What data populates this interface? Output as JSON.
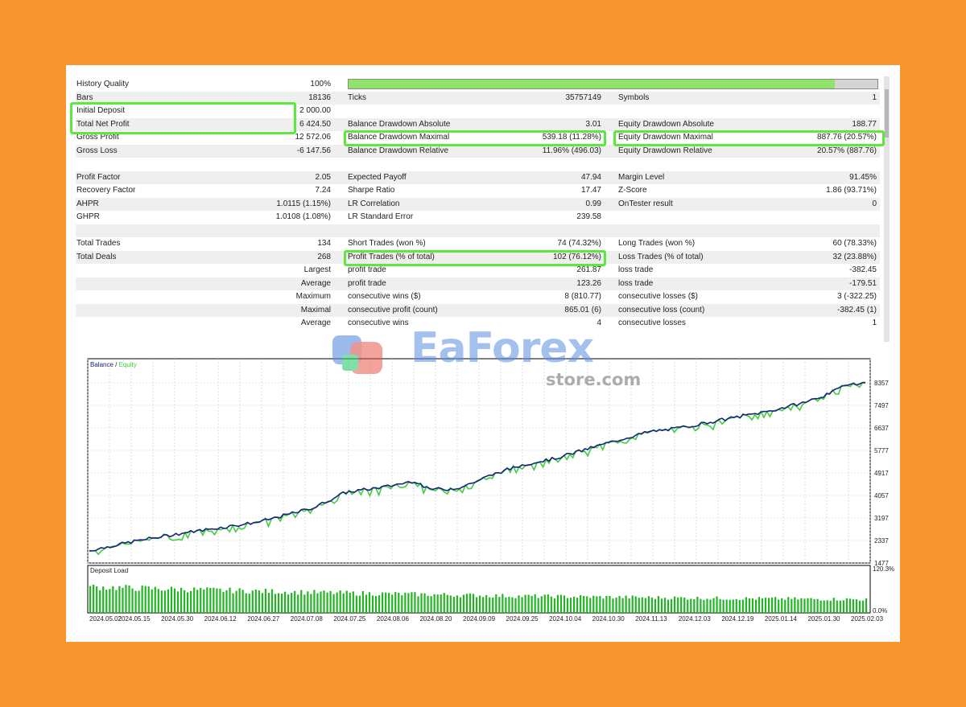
{
  "summary_left": [
    {
      "label": "History Quality",
      "value": "100%"
    },
    {
      "label": "Bars",
      "value": "18136"
    },
    {
      "label": "Initial Deposit",
      "value": "2 000.00"
    },
    {
      "label": "Total Net Profit",
      "value": "6 424.50"
    },
    {
      "label": "Gross Profit",
      "value": "12 572.06"
    },
    {
      "label": "Gross Loss",
      "value": "-6 147.56"
    },
    null,
    {
      "label": "Profit Factor",
      "value": "2.05"
    },
    {
      "label": "Recovery Factor",
      "value": "7.24"
    },
    {
      "label": "AHPR",
      "value": "1.0115 (1.15%)"
    },
    {
      "label": "GHPR",
      "value": "1.0108 (1.08%)"
    },
    null,
    {
      "label": "Total Trades",
      "value": "134"
    },
    {
      "label": "Total Deals",
      "value": "268"
    },
    {
      "label": "Largest",
      "value": ""
    },
    {
      "label": "Average",
      "value": ""
    },
    {
      "label": "Maximum",
      "value": ""
    },
    {
      "label": "Maximal",
      "value": ""
    },
    {
      "label": "Average",
      "value": ""
    }
  ],
  "summary_mid": [
    null,
    {
      "label": "Ticks",
      "value": "35757149"
    },
    null,
    {
      "label": "Balance Drawdown Absolute",
      "value": "3.01"
    },
    {
      "label": "Balance Drawdown Maximal",
      "value": "539.18 (11.28%)"
    },
    {
      "label": "Balance Drawdown Relative",
      "value": "11.96% (496.03)"
    },
    null,
    {
      "label": "Expected Payoff",
      "value": "47.94"
    },
    {
      "label": "Sharpe Ratio",
      "value": "17.47"
    },
    {
      "label": "LR Correlation",
      "value": "0.99"
    },
    {
      "label": "LR Standard Error",
      "value": "239.58"
    },
    null,
    {
      "label": "Short Trades (won %)",
      "value": "74 (74.32%)"
    },
    {
      "label": "Profit Trades (% of total)",
      "value": "102 (76.12%)"
    },
    {
      "label": "profit trade",
      "value": "261.87"
    },
    {
      "label": "profit trade",
      "value": "123.26"
    },
    {
      "label": "consecutive wins ($)",
      "value": "8 (810.77)"
    },
    {
      "label": "consecutive profit (count)",
      "value": "865.01 (6)"
    },
    {
      "label": "consecutive wins",
      "value": "4"
    }
  ],
  "summary_right": [
    null,
    {
      "label": "Symbols",
      "value": "1"
    },
    null,
    {
      "label": "Equity Drawdown Absolute",
      "value": "188.77"
    },
    {
      "label": "Equity Drawdown Maximal",
      "value": "887.76 (20.57%)"
    },
    {
      "label": "Equity Drawdown Relative",
      "value": "20.57% (887.76)"
    },
    null,
    {
      "label": "Margin Level",
      "value": "91.45%"
    },
    {
      "label": "Z-Score",
      "value": "1.86 (93.71%)"
    },
    {
      "label": "OnTester result",
      "value": "0"
    },
    null,
    null,
    {
      "label": "Long Trades (won %)",
      "value": "60 (78.33%)"
    },
    {
      "label": "Loss Trades (% of total)",
      "value": "32 (23.88%)"
    },
    {
      "label": "loss trade",
      "value": "-382.45"
    },
    {
      "label": "loss trade",
      "value": "-179.51"
    },
    {
      "label": "consecutive losses ($)",
      "value": "3 (-322.25)"
    },
    {
      "label": "consecutive loss (count)",
      "value": "-382.45 (1)"
    },
    {
      "label": "consecutive losses",
      "value": "1"
    }
  ],
  "history_quality_progress": 0.92,
  "highlight_color": "#5de83d",
  "watermark": {
    "brand": "EaForex",
    "sub": "store.com"
  },
  "chart_data": [
    {
      "type": "line",
      "legend": {
        "balance": "Balance",
        "separator": " / ",
        "equity": "Equity"
      },
      "colors": {
        "balance": "#1a237e",
        "equity": "#3fce3f"
      },
      "ylim": [
        1477,
        8357
      ],
      "y_ticks": [
        "8357",
        "7497",
        "6637",
        "5777",
        "4917",
        "4057",
        "3197",
        "2337",
        "1477"
      ],
      "x_ticks": [
        "2024.05.02",
        "2024.05.15",
        "2024.05.30",
        "2024.06.12",
        "2024.06.27",
        "2024.07.08",
        "2024.07.25",
        "2024.08.06",
        "2024.08.20",
        "2024.09.09",
        "2024.09.25",
        "2024.10.04",
        "2024.10.30",
        "2024.11.13",
        "2024.12.03",
        "2024.12.19",
        "2025.01.14",
        "2025.01.30",
        "2025.02.03"
      ],
      "balance_anchors": [
        [
          0,
          1950
        ],
        [
          0.06,
          2320
        ],
        [
          0.12,
          2620
        ],
        [
          0.22,
          3050
        ],
        [
          0.29,
          3600
        ],
        [
          0.33,
          4180
        ],
        [
          0.38,
          4380
        ],
        [
          0.42,
          4620
        ],
        [
          0.435,
          4320
        ],
        [
          0.46,
          4290
        ],
        [
          0.48,
          4380
        ],
        [
          0.52,
          4860
        ],
        [
          0.56,
          5240
        ],
        [
          0.6,
          5470
        ],
        [
          0.64,
          5820
        ],
        [
          0.68,
          6160
        ],
        [
          0.72,
          6480
        ],
        [
          0.76,
          6630
        ],
        [
          0.8,
          6860
        ],
        [
          0.84,
          7080
        ],
        [
          0.88,
          7300
        ],
        [
          0.92,
          7600
        ],
        [
          0.955,
          7950
        ],
        [
          0.975,
          8310
        ],
        [
          1.0,
          8357
        ]
      ]
    },
    {
      "type": "bar",
      "title": "Deposit Load",
      "y_ticks": [
        "120.3%",
        "0.0%"
      ],
      "ylim": [
        0,
        120.3
      ],
      "anchors": [
        [
          0,
          85
        ],
        [
          0.1,
          78
        ],
        [
          0.3,
          66
        ],
        [
          0.55,
          55
        ],
        [
          0.8,
          48
        ],
        [
          1.0,
          44
        ]
      ]
    }
  ]
}
